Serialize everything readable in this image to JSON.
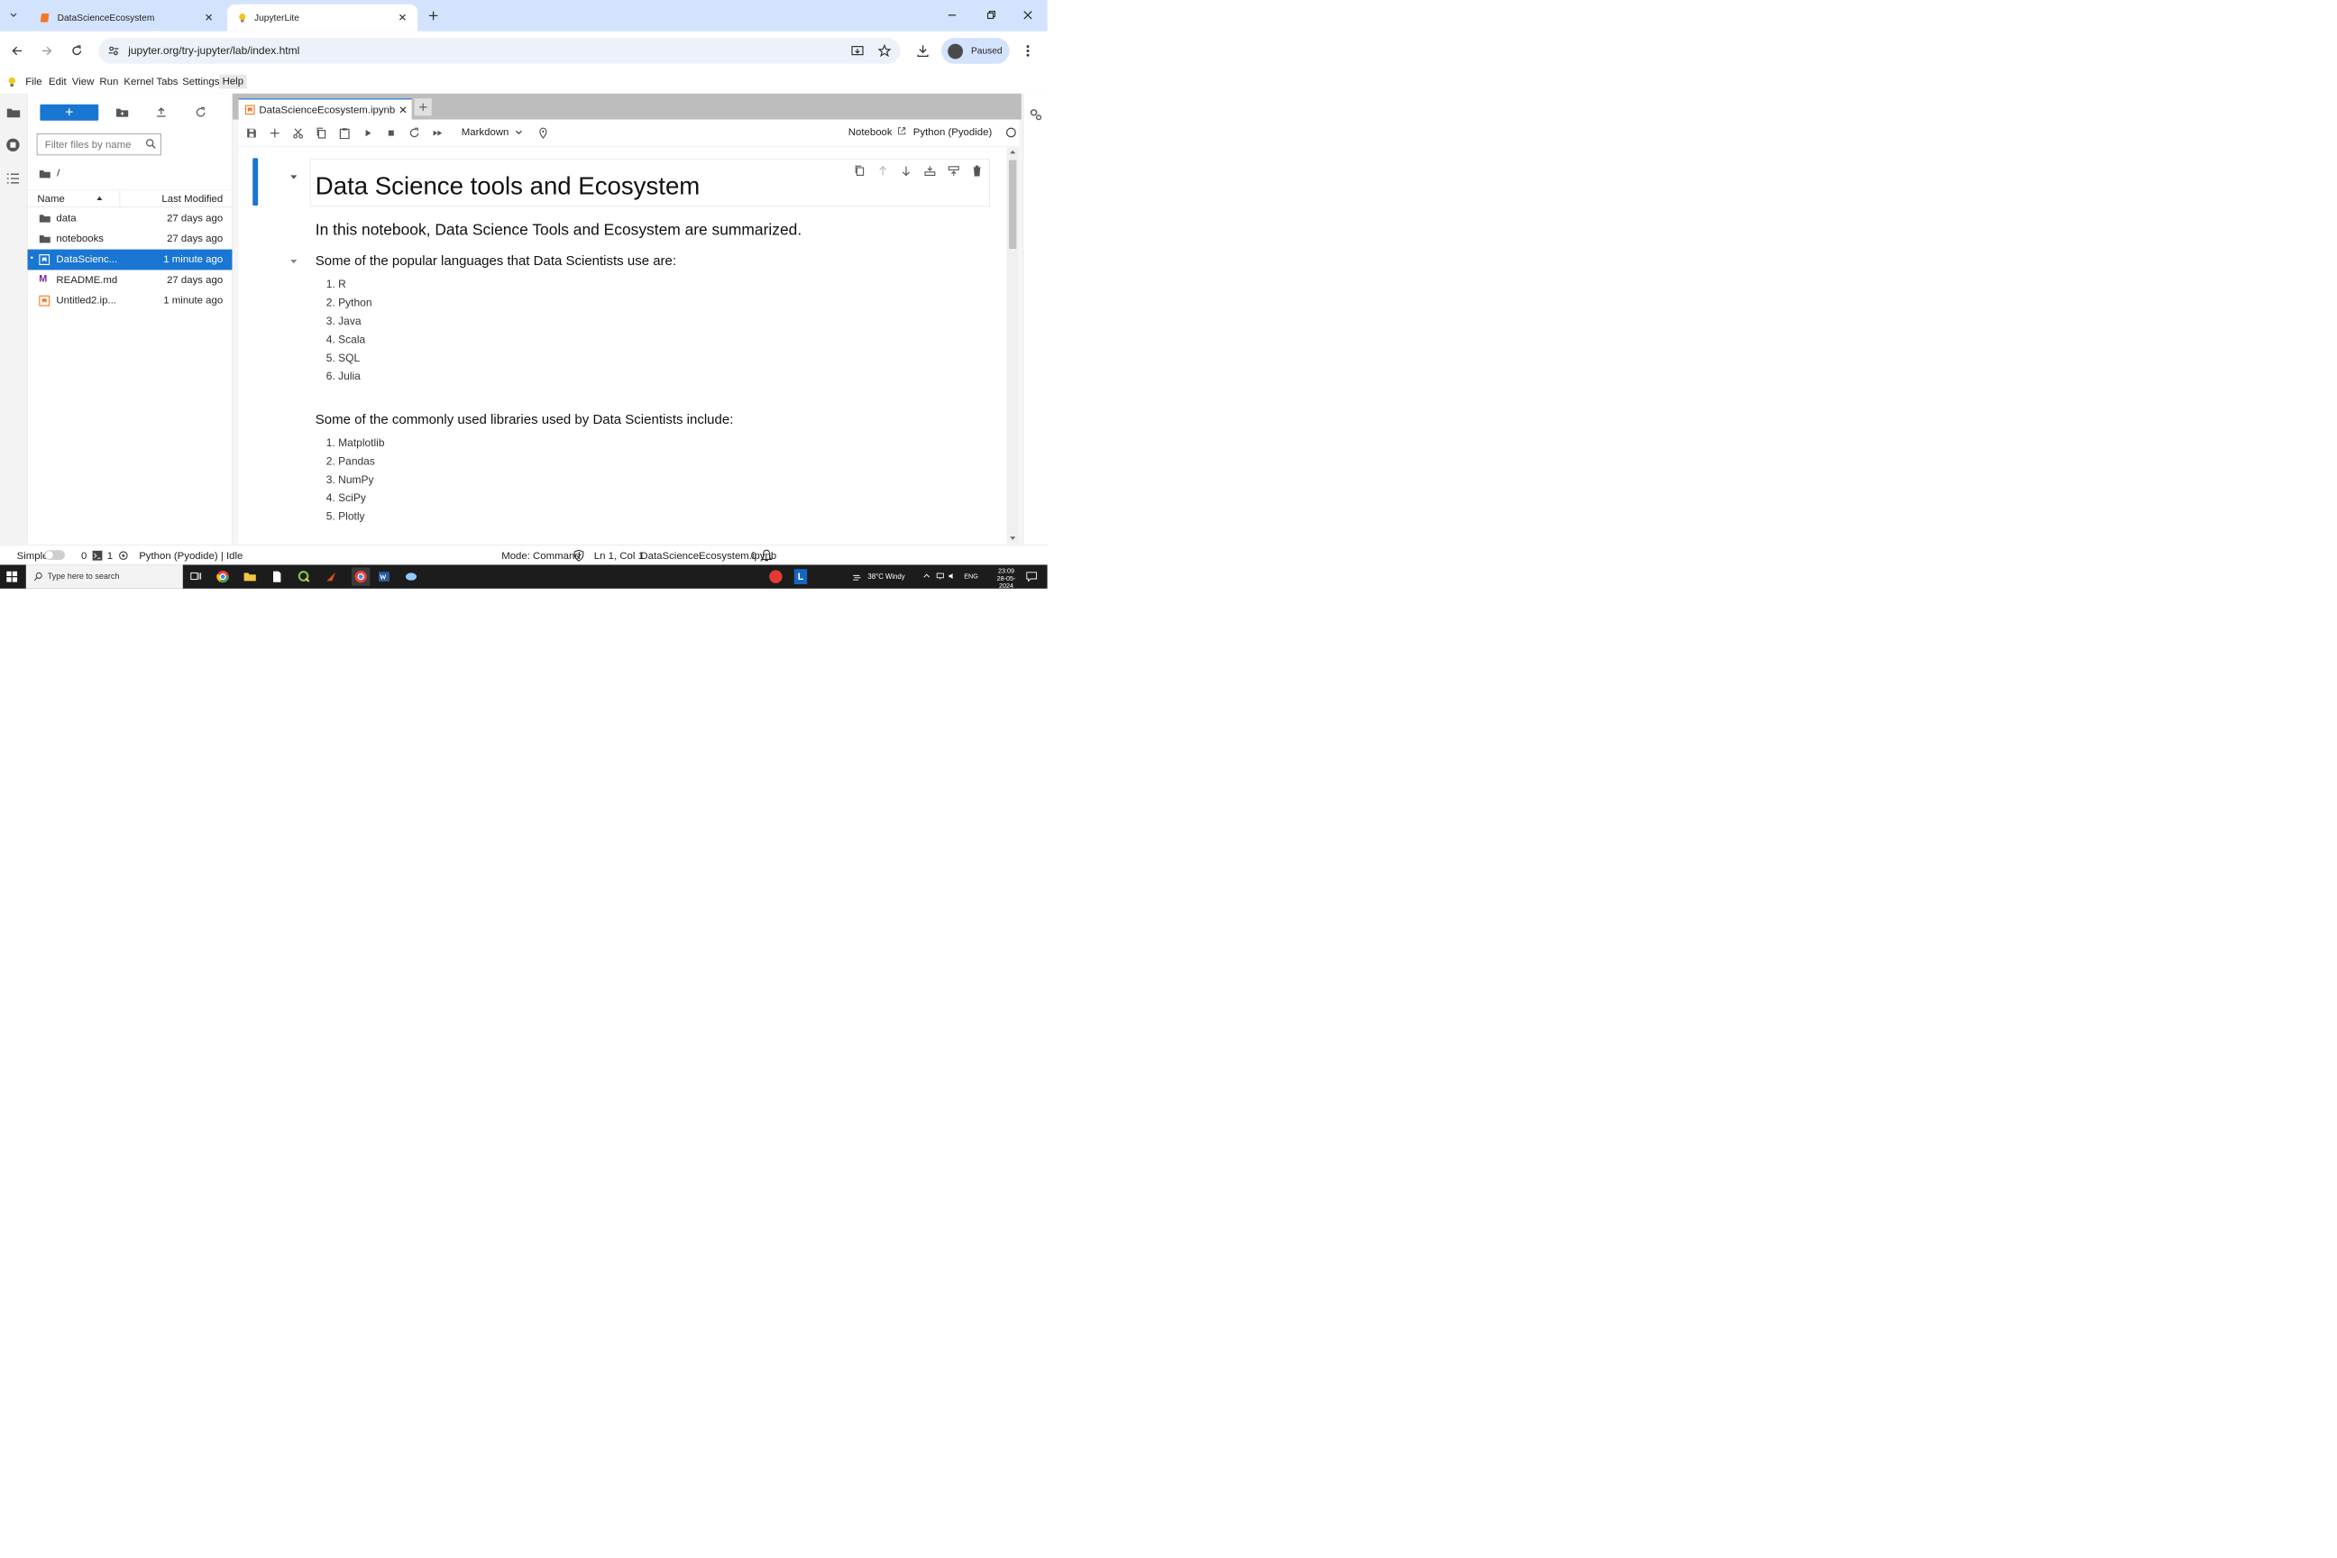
{
  "browser": {
    "tabs": [
      {
        "title": "DataScienceEcosystem"
      },
      {
        "title": "JupyterLite"
      }
    ],
    "url": "jupyter.org/try-jupyter/lab/index.html",
    "profile_label": "Paused"
  },
  "menubar": {
    "items": [
      "File",
      "Edit",
      "View",
      "Run",
      "Kernel",
      "Tabs",
      "Settings",
      "Help"
    ]
  },
  "filebrowser": {
    "new_label": "+",
    "filter_placeholder": "Filter files by name",
    "path": "/",
    "col_name": "Name",
    "col_modified": "Last Modified",
    "files": [
      {
        "name": "data",
        "modified": "27 days ago",
        "type": "folder"
      },
      {
        "name": "notebooks",
        "modified": "27 days ago",
        "type": "folder"
      },
      {
        "name": "DataScienc...",
        "modified": "1 minute ago",
        "type": "notebook",
        "selected": true
      },
      {
        "name": "README.md",
        "modified": "27 days ago",
        "type": "markdown"
      },
      {
        "name": "Untitled2.ip...",
        "modified": "1 minute ago",
        "type": "notebook"
      }
    ]
  },
  "notebook": {
    "tab_title": "DataScienceEcosystem.ipynb",
    "cell_type": "Markdown",
    "notebook_link": "Notebook",
    "kernel": "Python (Pyodide)",
    "title": "Data Science tools and Ecosystem",
    "intro": "In this notebook, Data Science Tools and Ecosystem are summarized.",
    "languages_heading": "Some of the popular languages that Data Scientists use are:",
    "languages": [
      "R",
      "Python",
      "Java",
      "Scala",
      "SQL",
      "Julia"
    ],
    "libraries_heading": "Some of the commonly used libraries used by Data Scientists include:",
    "libraries": [
      "Matplotlib",
      "Pandas",
      "NumPy",
      "SciPy",
      "Plotly"
    ]
  },
  "statusbar": {
    "simple_label": "Simple",
    "terminals": "0",
    "kernels": "1",
    "kernel_status": "Python (Pyodide) | Idle",
    "mode": "Mode: Command",
    "position": "Ln 1, Col 1",
    "filename": "DataScienceEcosystem.ipynb",
    "notifications": "0"
  },
  "taskbar": {
    "search_placeholder": "Type here to search",
    "weather": "38°C  Windy",
    "lang": "ENG",
    "time": "23:09",
    "date": "28-05-2024"
  },
  "colors": {
    "accent": "#1976d2",
    "tabstrip": "#d3e3fd",
    "taskbar": "#1c1c1c"
  }
}
